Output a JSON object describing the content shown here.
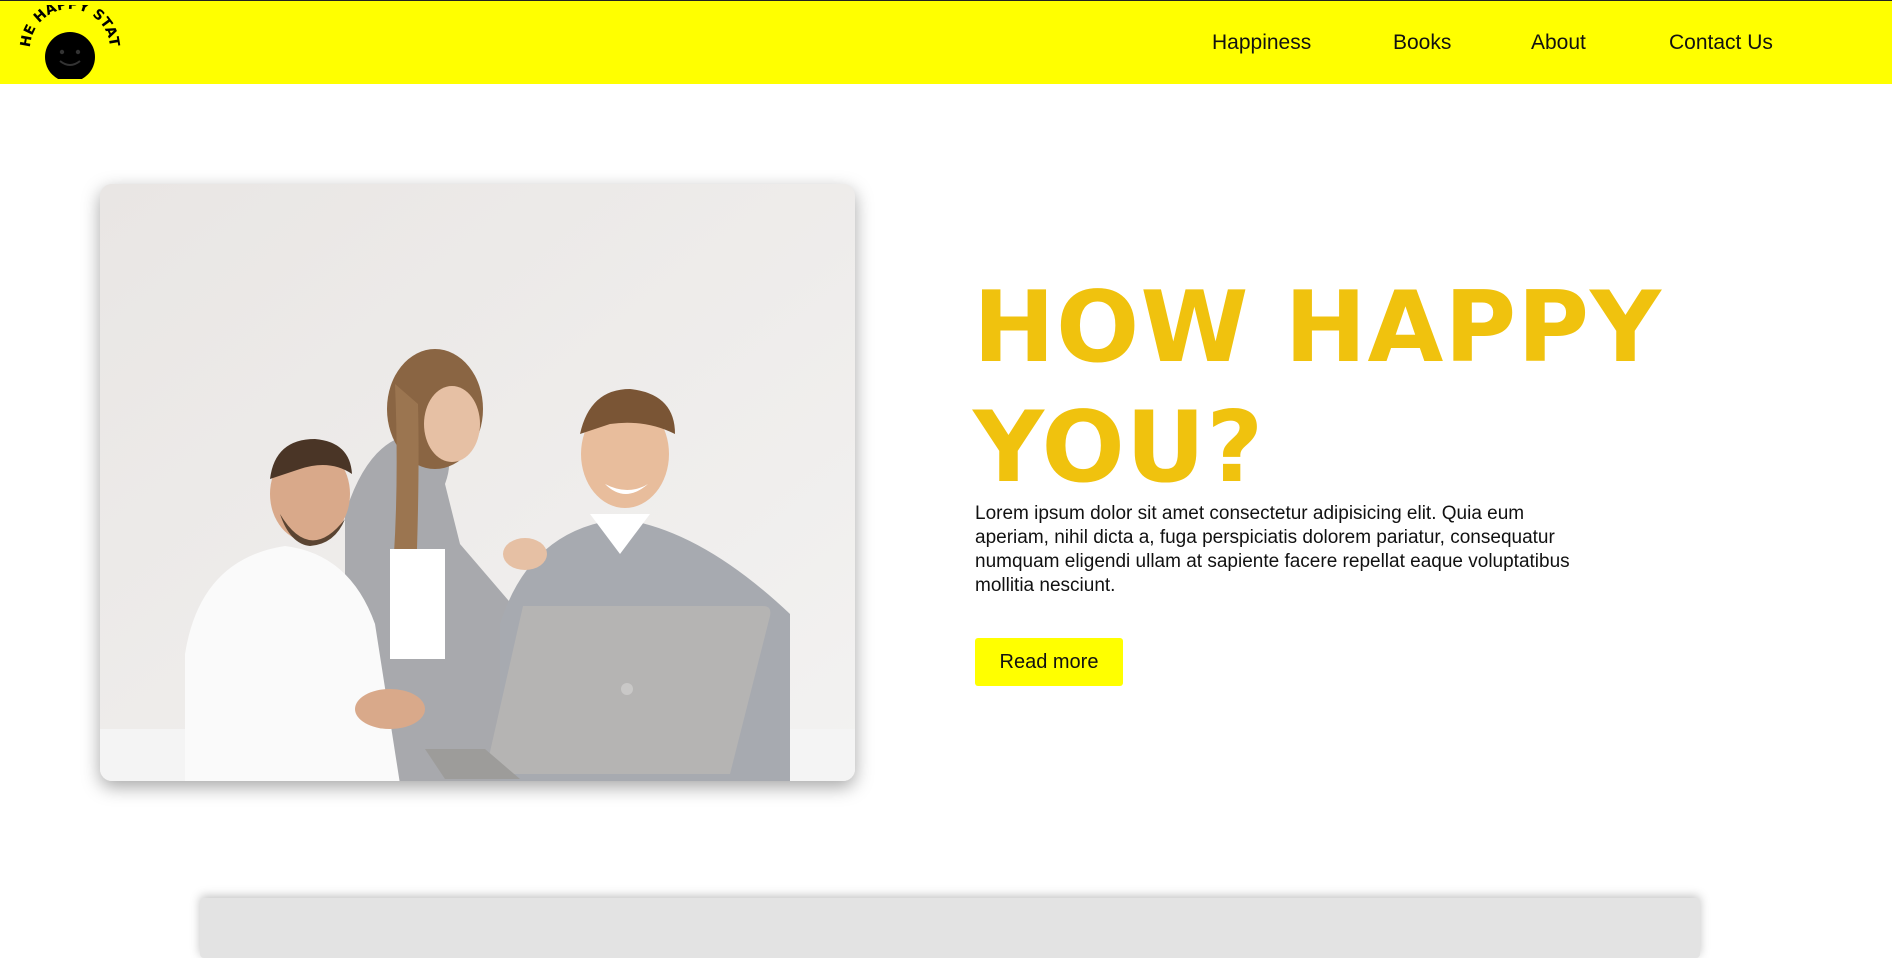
{
  "brand": {
    "logo_text": "THE HAPPY STATS",
    "colors": {
      "nav_bg": "#ffff00",
      "accent_title": "#f0c20e",
      "button_bg": "#ffff00"
    }
  },
  "nav": {
    "items": [
      {
        "label": "Happiness"
      },
      {
        "label": "Books"
      },
      {
        "label": "About"
      },
      {
        "label": "Contact Us"
      }
    ]
  },
  "hero": {
    "title_line1": "HOW HAPPY",
    "title_line2": "YOU?",
    "body": "Lorem ipsum dolor sit amet consectetur adipisicing elit. Quia eum aperiam, nihil dicta a, fuga perspiciatis dolorem pariatur, consequatur numquam eligendi ullam at sapiente facere repellat eaque voluptatibus mollitia nesciunt.",
    "button_label": "Read more",
    "image_alt": "Three smiling colleagues looking at a laptop"
  }
}
